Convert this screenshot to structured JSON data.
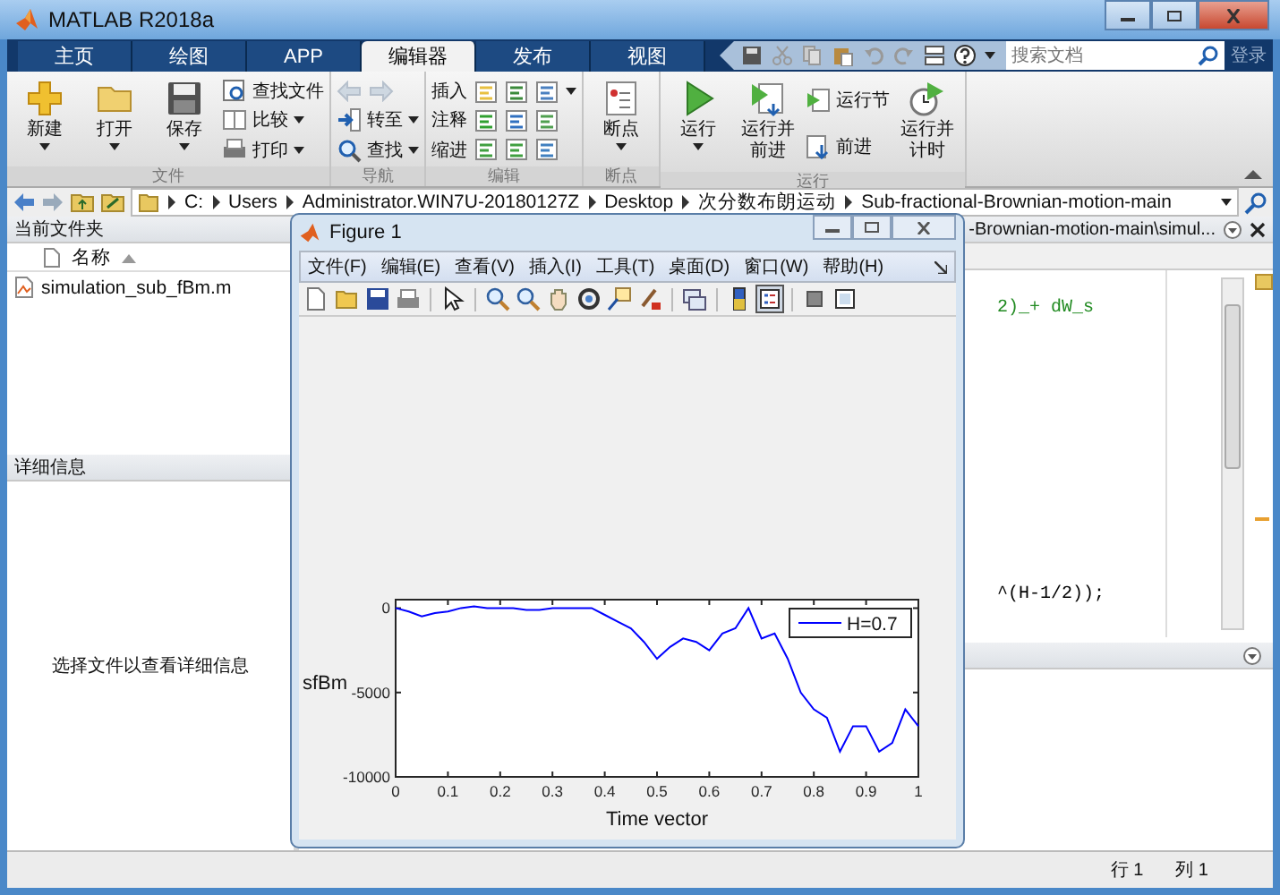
{
  "window": {
    "title": "MATLAB R2018a"
  },
  "tabs": [
    {
      "label": "主页",
      "selected": false
    },
    {
      "label": "绘图",
      "selected": false
    },
    {
      "label": "APP",
      "selected": false
    },
    {
      "label": "编辑器",
      "selected": true
    },
    {
      "label": "发布",
      "selected": false
    },
    {
      "label": "视图",
      "selected": false
    }
  ],
  "search": {
    "placeholder": "搜索文档"
  },
  "login": "登录",
  "ribbon": [
    {
      "label": "文件",
      "items": [
        {
          "kind": "large",
          "label": "新建",
          "caret": true
        },
        {
          "kind": "large",
          "label": "打开",
          "caret": true
        },
        {
          "kind": "large",
          "label": "保存",
          "caret": true
        },
        {
          "kind": "column",
          "rows": [
            {
              "kind": "small",
              "label": "查找文件",
              "caret": false
            },
            {
              "kind": "small",
              "label": "比较",
              "caret": true
            },
            {
              "kind": "small",
              "label": "打印",
              "caret": true
            }
          ]
        }
      ]
    },
    {
      "label": "导航",
      "items": [
        {
          "kind": "column",
          "rows": [
            {
              "kind": "arrows",
              "disabled": true
            },
            {
              "kind": "small",
              "label": "转至",
              "caret": true
            },
            {
              "kind": "small",
              "label": "查找",
              "caret": true
            }
          ]
        }
      ]
    },
    {
      "label": "编辑",
      "items": [
        {
          "kind": "column",
          "rows": [
            {
              "kind": "tools",
              "label": "插入",
              "caret": true
            },
            {
              "kind": "tools",
              "label": "注释",
              "caret": false
            },
            {
              "kind": "tools",
              "label": "缩进",
              "caret": false
            }
          ]
        }
      ]
    },
    {
      "label": "断点",
      "items": [
        {
          "kind": "large",
          "label": "断点",
          "caret": true
        }
      ]
    },
    {
      "label": "运行",
      "items": [
        {
          "kind": "large",
          "label": "运行",
          "caret": true
        },
        {
          "kind": "large",
          "label": "运行并前进",
          "caret": false
        },
        {
          "kind": "column",
          "rows": [
            {
              "kind": "small",
              "label": "运行节",
              "caret": false
            },
            {
              "kind": "small",
              "label": "前进",
              "caret": false
            }
          ]
        },
        {
          "kind": "large",
          "label": "运行并计时",
          "caret": false
        }
      ]
    }
  ],
  "address": [
    "C:",
    "Users",
    "Administrator.WIN7U-20180127Z",
    "Desktop",
    "次分数布朗运动",
    "Sub-fractional-Brownian-motion-main"
  ],
  "current_folder": {
    "title": "当前文件夹",
    "column": "名称",
    "files": [
      "simulation_sub_fBm.m"
    ]
  },
  "details": {
    "title": "详细信息",
    "message": "选择文件以查看详细信息"
  },
  "editor": {
    "tab": "-Brownian-motion-main\\simul...",
    "lines": [
      {
        "text": "2)_+ dW_s",
        "kind": "comment"
      },
      {
        "text": "^(H-1/2));",
        "kind": "code"
      }
    ]
  },
  "status": {
    "line": "行 1",
    "column": "列 1"
  },
  "figure": {
    "title": "Figure 1",
    "menu": [
      "文件(F)",
      "编辑(E)",
      "查看(V)",
      "插入(I)",
      "工具(T)",
      "桌面(D)",
      "窗口(W)",
      "帮助(H)"
    ],
    "legend_tool_pressed": true,
    "chart_data": {
      "type": "line",
      "xlabel": "Time vector",
      "ylabel": "sfBm",
      "xlim": [
        0,
        1
      ],
      "ylim": [
        -10000,
        500
      ],
      "xticks": [
        0,
        0.1,
        0.2,
        0.3,
        0.4,
        0.5,
        0.6,
        0.7,
        0.8,
        0.9,
        1
      ],
      "yticks": [
        -10000,
        -5000,
        0
      ],
      "x": [
        0,
        0.025,
        0.05,
        0.075,
        0.1,
        0.125,
        0.15,
        0.175,
        0.2,
        0.225,
        0.25,
        0.275,
        0.3,
        0.325,
        0.35,
        0.375,
        0.4,
        0.425,
        0.45,
        0.475,
        0.5,
        0.525,
        0.55,
        0.575,
        0.6,
        0.625,
        0.65,
        0.675,
        0.7,
        0.725,
        0.75,
        0.775,
        0.8,
        0.825,
        0.85,
        0.875,
        0.9,
        0.925,
        0.95,
        0.975,
        1
      ],
      "series": [
        {
          "name": "H=0.7",
          "color": "#0000ff",
          "values": [
            0,
            -200,
            -500,
            -300,
            -200,
            0,
            100,
            0,
            0,
            0,
            -100,
            -100,
            0,
            0,
            0,
            0,
            -400,
            -800,
            -1200,
            -2000,
            -3000,
            -2300,
            -1800,
            -2000,
            -2500,
            -1500,
            -1200,
            0,
            -1800,
            -1500,
            -3000,
            -5000,
            -6000,
            -6500,
            -8500,
            -7000,
            -7000,
            -8500,
            -8000,
            -6000,
            -7000
          ]
        }
      ]
    }
  }
}
